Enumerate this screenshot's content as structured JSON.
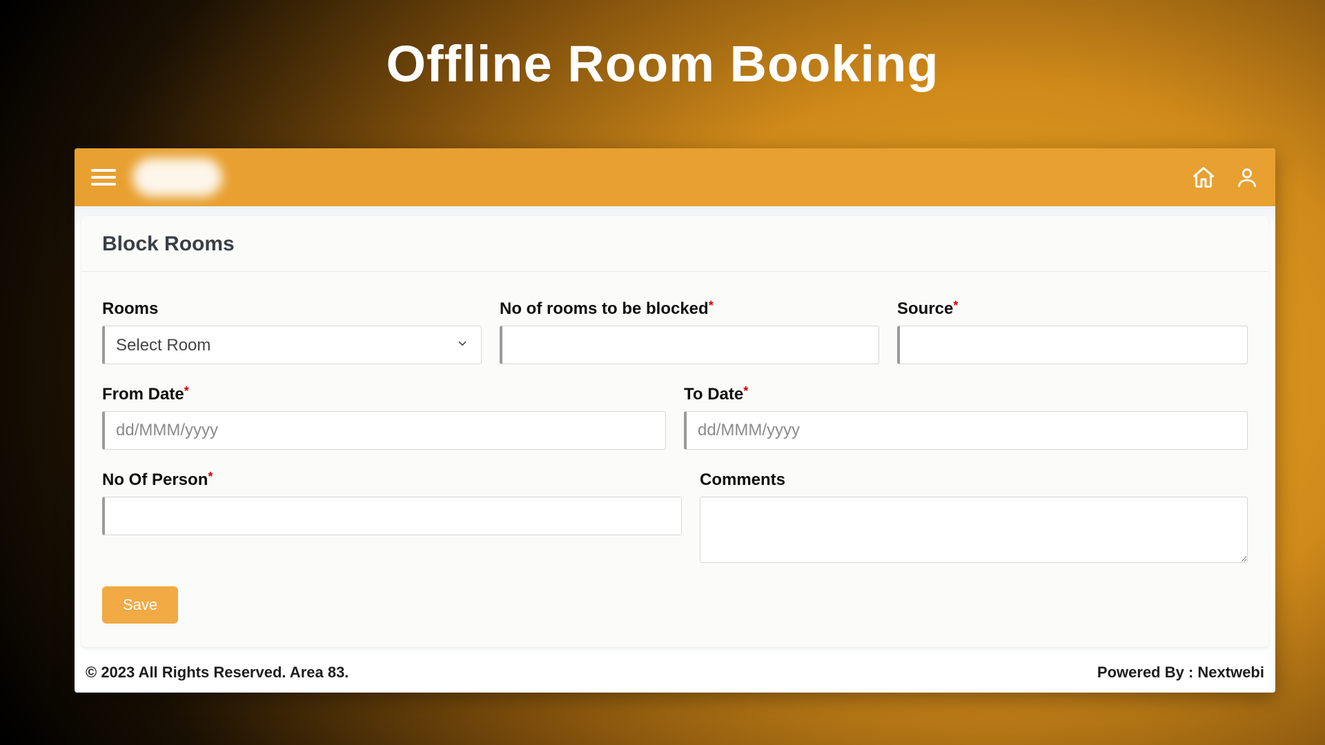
{
  "hero": {
    "title": "Offline Room Booking"
  },
  "topbar": {
    "menu_icon": "hamburger-icon",
    "home_icon": "home-icon",
    "user_icon": "user-icon"
  },
  "panel": {
    "title": "Block Rooms"
  },
  "form": {
    "rooms": {
      "label": "Rooms",
      "placeholder": "Select Room",
      "value": ""
    },
    "blocked": {
      "label": "No of rooms to be blocked",
      "required": true,
      "value": ""
    },
    "source": {
      "label": "Source",
      "required": true,
      "value": ""
    },
    "from_date": {
      "label": "From Date",
      "required": true,
      "placeholder": "dd/MMM/yyyy",
      "value": ""
    },
    "to_date": {
      "label": "To Date",
      "required": true,
      "placeholder": "dd/MMM/yyyy",
      "value": ""
    },
    "persons": {
      "label": "No Of Person",
      "required": true,
      "value": ""
    },
    "comments": {
      "label": "Comments",
      "value": ""
    },
    "save_label": "Save"
  },
  "footer": {
    "left": "© 2023 All Rights Reserved. Area 83.",
    "right": "Powered By : Nextwebi"
  }
}
